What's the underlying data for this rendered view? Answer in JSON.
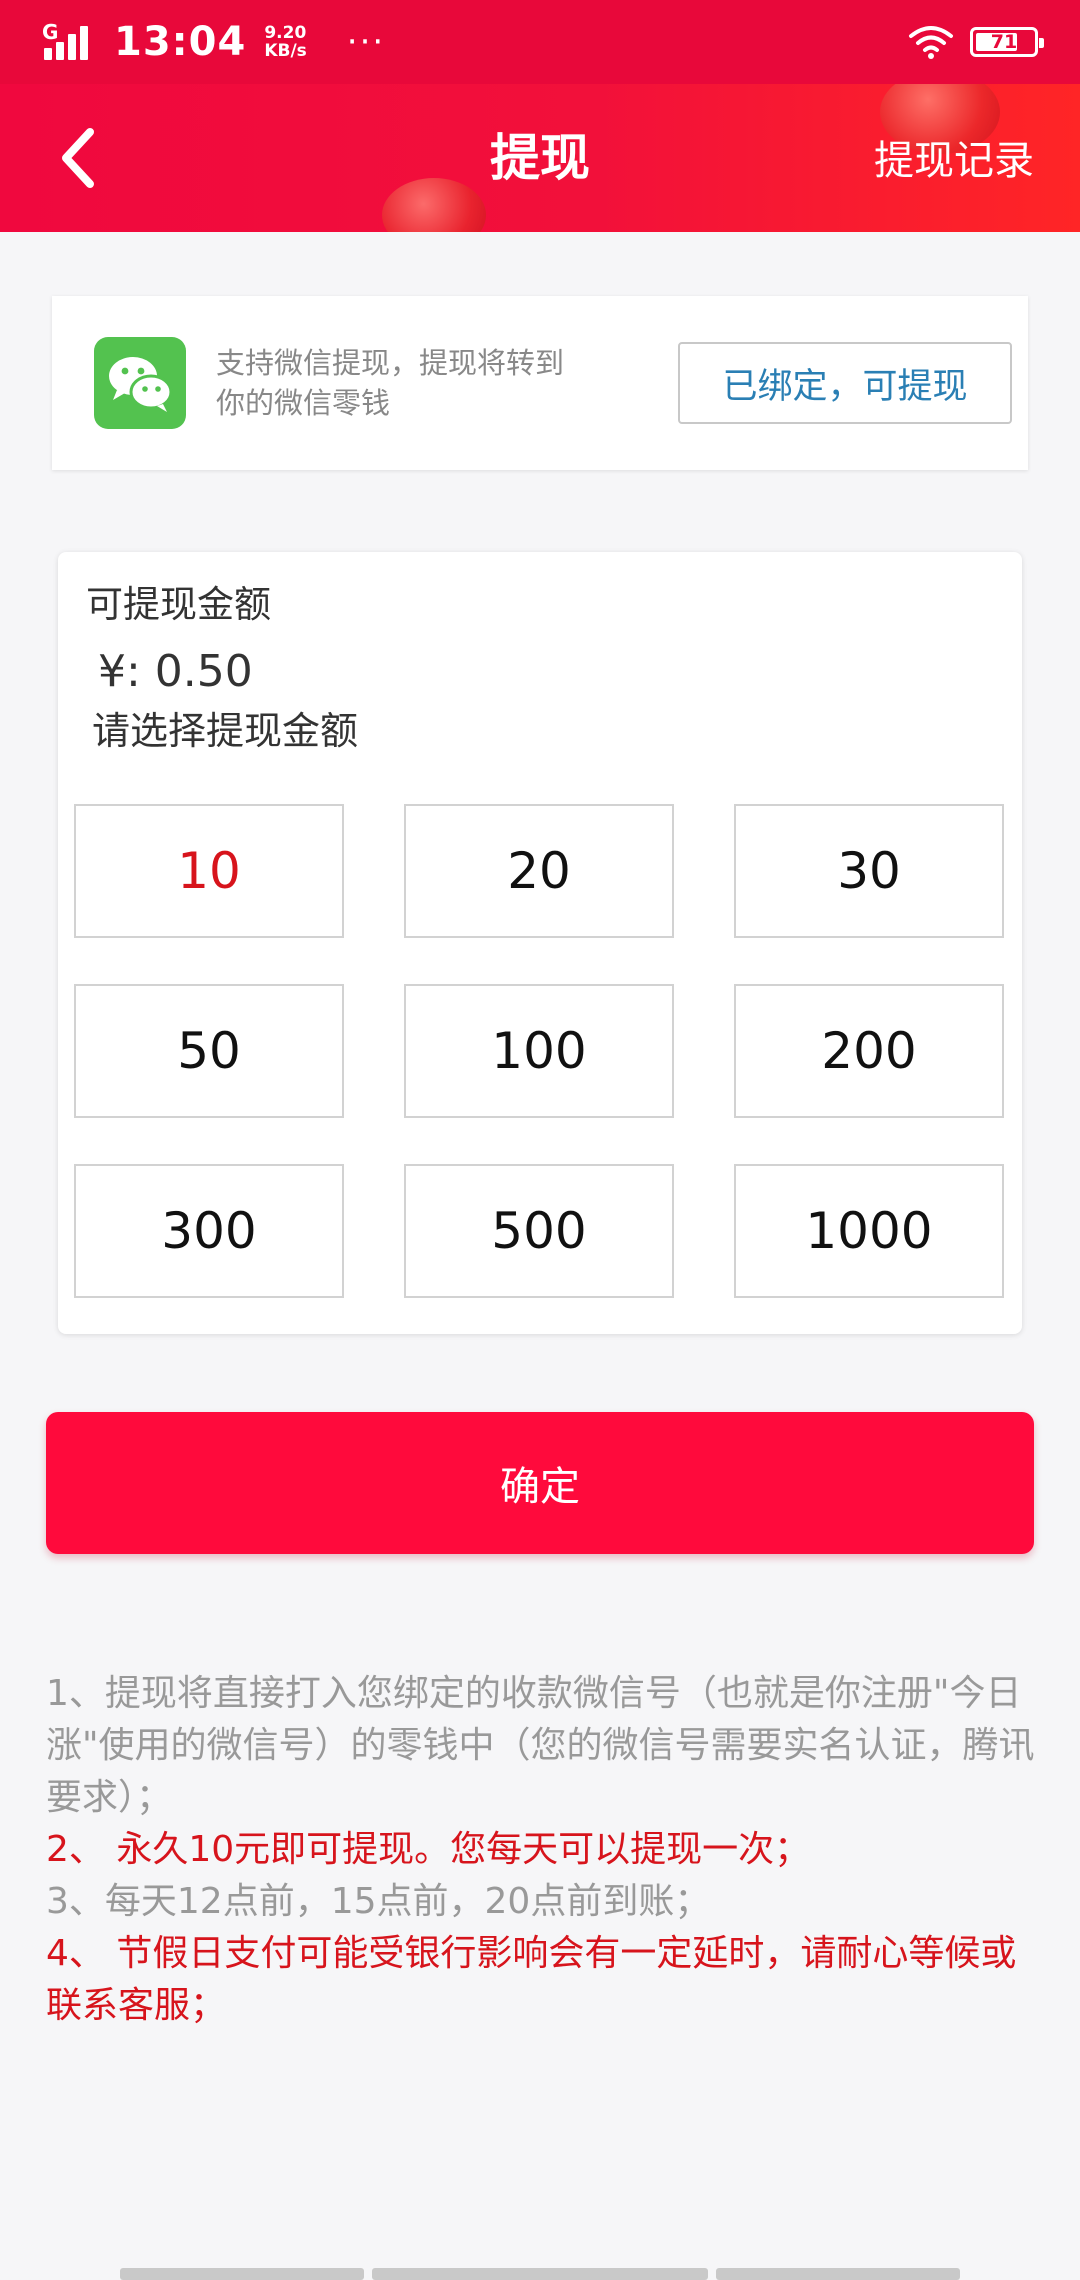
{
  "status_bar": {
    "network": "G",
    "time": "13:04",
    "speed_value": "9.20",
    "speed_unit": "KB/s",
    "more": "···",
    "battery": "71"
  },
  "header": {
    "title": "提现",
    "link": "提现记录"
  },
  "wechat": {
    "description": "支持微信提现，提现将转到你的微信零钱",
    "bind_status": "已绑定，可提现"
  },
  "amount": {
    "label": "可提现金额",
    "balance": "¥: 0.50",
    "choose_label": "请选择提现金额",
    "selected": "10",
    "options": [
      "10",
      "20",
      "30",
      "50",
      "100",
      "200",
      "300",
      "500",
      "1000"
    ]
  },
  "confirm_label": "确定",
  "notes": [
    "1、提现将直接打入您绑定的收款微信号（也就是你注册\"今日涨\"使用的微信号）的零钱中（您的微信号需要实名认证，腾讯要求）；",
    "2、 永久10元即可提现。您每天可以提现一次；",
    "3、每天12点前，15点前，20点前到账；",
    "4、 节假日支付可能受银行影响会有一定延时，请耐心等候或联系客服；"
  ],
  "colors": {
    "brand": "#f0083e",
    "selected_text": "#d7141c",
    "bind_text": "#2a7fb4",
    "wechat_green": "#53c24f"
  }
}
